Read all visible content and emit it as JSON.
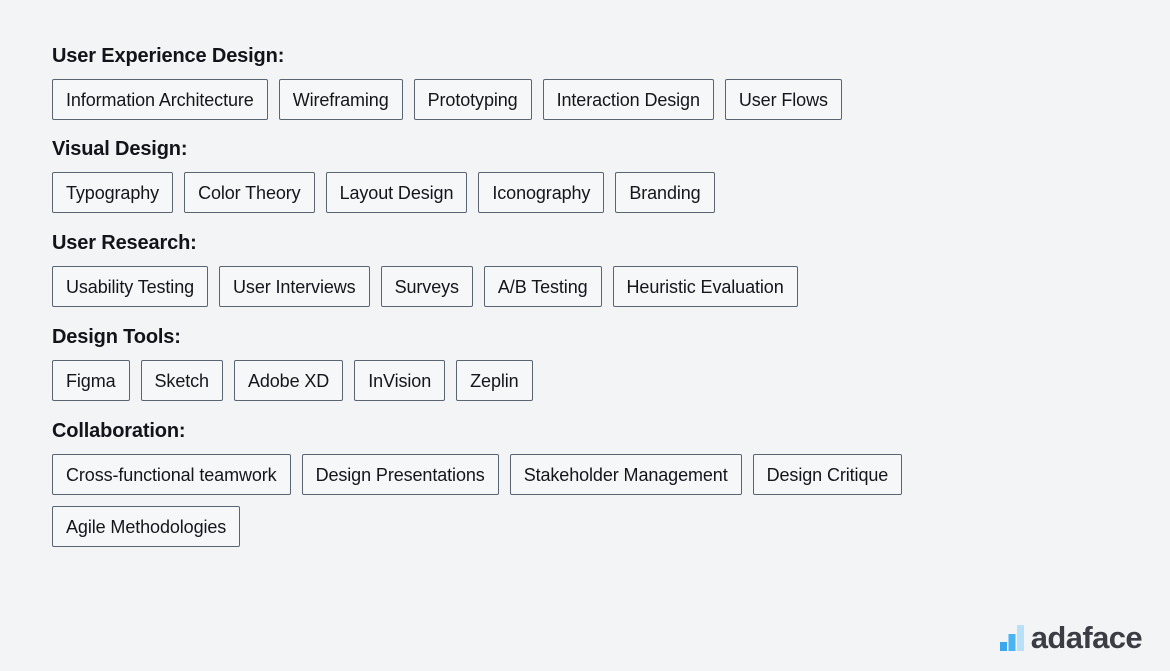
{
  "page": {
    "background_color": "#f3f4f6",
    "tag_border_color": "#5b6471",
    "tag_background_color": "#f6f7f8",
    "heading_color": "#12141a"
  },
  "sections": [
    {
      "heading": "User Experience Design:",
      "tags": [
        "Information Architecture",
        "Wireframing",
        "Prototyping",
        "Interaction Design",
        "User Flows"
      ]
    },
    {
      "heading": "Visual Design:",
      "tags": [
        "Typography",
        "Color Theory",
        "Layout Design",
        "Iconography",
        "Branding"
      ]
    },
    {
      "heading": "User Research:",
      "tags": [
        "Usability Testing",
        "User Interviews",
        "Surveys",
        "A/B Testing",
        "Heuristic Evaluation"
      ]
    },
    {
      "heading": "Design Tools:",
      "tags": [
        "Figma",
        "Sketch",
        "Adobe XD",
        "InVision",
        "Zeplin"
      ]
    },
    {
      "heading": "Collaboration:",
      "tags": [
        "Cross-functional teamwork",
        "Design Presentations",
        "Stakeholder Management",
        "Design Critique",
        "Agile Methodologies"
      ]
    }
  ],
  "brand": {
    "name": "adaface",
    "icon": "bar-chart-logo-icon",
    "text_color": "#3c3d44",
    "bar_colors": [
      "#3aa6ef",
      "#49b4f4",
      "#b9e0f9"
    ]
  }
}
